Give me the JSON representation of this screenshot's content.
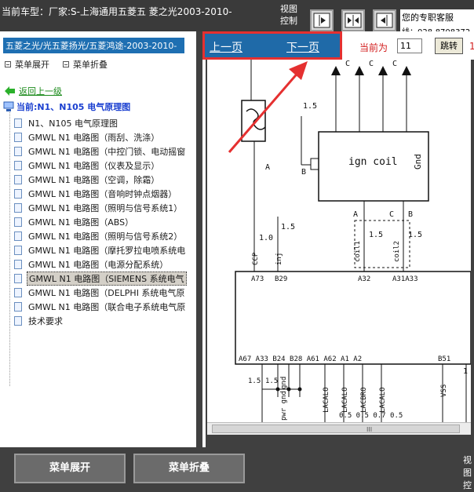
{
  "header": {
    "vehicle_title": "当前车型：厂家:S-上海通用五菱五  菱之光2003-2010-",
    "view_control_label": "视图控制",
    "support_text": "您的专职客服",
    "support_phone": "线：028-8708372"
  },
  "left_panel": {
    "path": "五菱之光/光五菱扬光/五菱鸿途-2003-2010-",
    "menu_expand": "菜单展开",
    "menu_collapse": "菜单折叠",
    "back_label": "返回上一级",
    "current_label": "当前:N1、N105 电气原理图",
    "tree_items": [
      {
        "label": "N1、N105 电气原理图"
      },
      {
        "label": "GMWL N1 电路图（雨刮、洗涤）"
      },
      {
        "label": "GMWL N1 电路图（中控门锁、电动摇窗"
      },
      {
        "label": "GMWL N1 电路图（仪表及显示）"
      },
      {
        "label": "GMWL N1 电路图（空调，除霜）"
      },
      {
        "label": "GMWL N1 电路图（音响时钟点烟器）"
      },
      {
        "label": "GMWL N1 电路图（照明与信号系统1）"
      },
      {
        "label": "GMWL N1 电路图（ABS）"
      },
      {
        "label": "GMWL N1 电路图（照明与信号系统2）"
      },
      {
        "label": "GMWL N1 电路图（摩托罗拉电喷系统电"
      },
      {
        "label": "GMWL N1 电路图（电源分配系统）"
      },
      {
        "label": "GMWL N1 电路图（SIEMENS 系统电气"
      },
      {
        "label": "GMWL N1 电路图（DELPHI 系统电气原"
      },
      {
        "label": "GMWL N1 电路图（联合电子系统电气原"
      },
      {
        "label": "技术要求"
      }
    ],
    "selected_index": 11
  },
  "nav": {
    "prev_page": "上一页",
    "next_page": "下一页",
    "current_page_label": "当前为",
    "page_value": "11",
    "jump_button": "跳转",
    "edge_text": "1"
  },
  "diagram": {
    "labels_top": [
      "C",
      "C",
      "C"
    ],
    "wire_15_left": "1.5",
    "wire_15_right": "1.5",
    "ign_coil": "ign coil",
    "gnd": "Gnd",
    "label_a_left": "A",
    "label_b": "B",
    "label_a_coil": "A",
    "label_c_coil": "C",
    "label_b_coil": "B",
    "wire_10": "1.0",
    "wire_15_mid": "1.5",
    "wire_15_a": "1.5",
    "wire_15_b": "1.5",
    "ccp": "CCP",
    "inj": "inj",
    "coil1": "coil1",
    "coil2": "coil2",
    "pin_a73": "A73",
    "pin_b29": "B29",
    "pin_a32": "A32",
    "pin_a31a33": "A31A33",
    "pin_row": "A67 A33 B24 B28   A61 A62  A1  A2",
    "pin_b51": "B51",
    "bottom_15a": "1.5",
    "bottom_15b": "1.5",
    "gnd_low": "gnd",
    "pwr_gnd": "pwr gnd",
    "lacalo1": "LACALO",
    "lacalo2": "LACALO",
    "lacbro": "LACBRO",
    "lacalo3": "LACALO",
    "vss": "VSS",
    "bottom_vals": "0.5  0.5  0.7  0.5",
    "right_1": "1"
  },
  "scroll": {
    "grip": "III"
  },
  "bottom": {
    "expand_button": "菜单展开",
    "collapse_button": "菜单折叠",
    "view_label": "视图控"
  },
  "colors": {
    "header_bg": "#3a3a3a",
    "path_bg": "#1e6fb2",
    "nav_bg": "#1f6aa8",
    "highlight_red": "#e53030",
    "bottom_button_bg": "#6b6b6b"
  }
}
